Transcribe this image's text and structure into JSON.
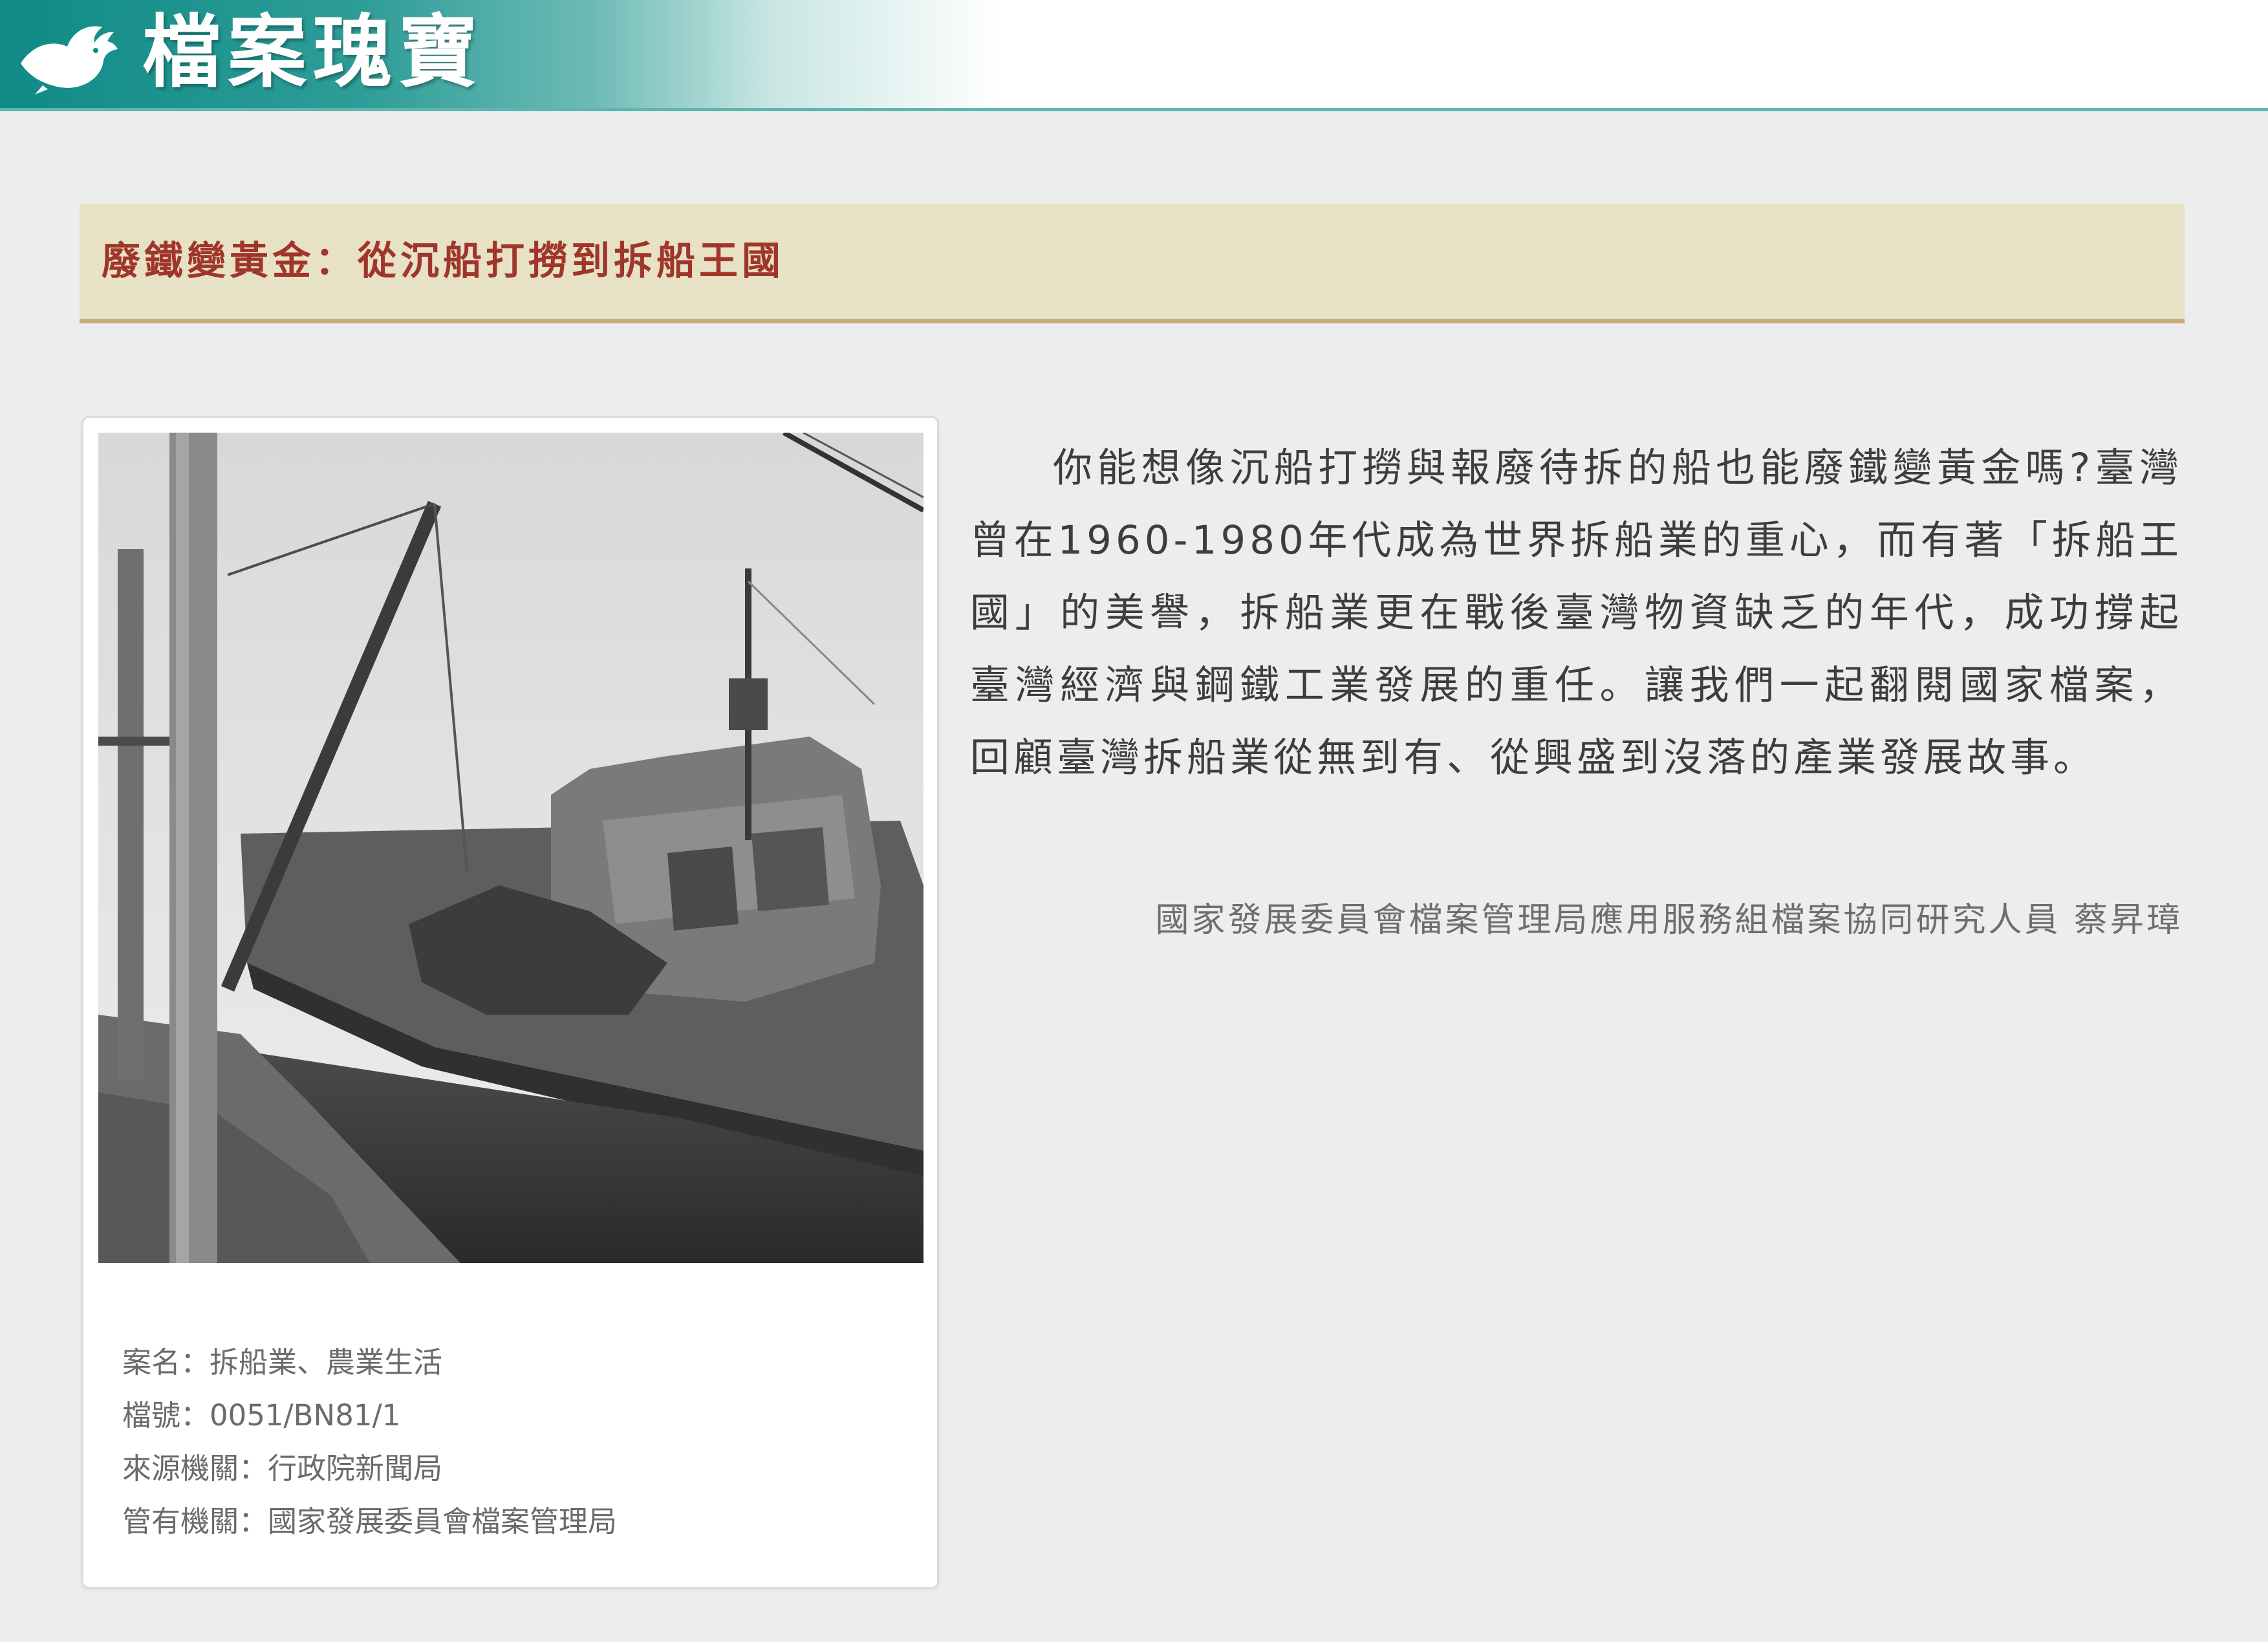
{
  "header": {
    "brand": "檔案瑰寶",
    "logo_icon": "bird-logo-icon",
    "colors": {
      "teal": "#0f8a86",
      "accent_line": "#5fb6b0"
    }
  },
  "article": {
    "title": "廢鐵變黃金：從沉船打撈到拆船王國",
    "title_color": "#a0362b",
    "title_bar_color": "#e7e2c5",
    "body": "你能想像沉船打撈與報廢待拆的船也能廢鐵變黃金嗎?臺灣曾在1960-1980年代成為世界拆船業的重心，而有著「拆船王國」的美譽，拆船業更在戰後臺灣物資缺乏的年代，成功撐起臺灣經濟與鋼鐵工業發展的重任。讓我們一起翻閱國家檔案，回顧臺灣拆船業從無到有、從興盛到沒落的產業發展故事。",
    "author": "國家發展委員會檔案管理局應用服務組檔案協同研究人員 蔡昇璋"
  },
  "photo_card": {
    "meta": [
      "案名：拆船業、農業生活",
      "檔號：0051/BN81/1",
      "來源機關：行政院新聞局",
      "管有機關：國家發展委員會檔案管理局"
    ]
  }
}
